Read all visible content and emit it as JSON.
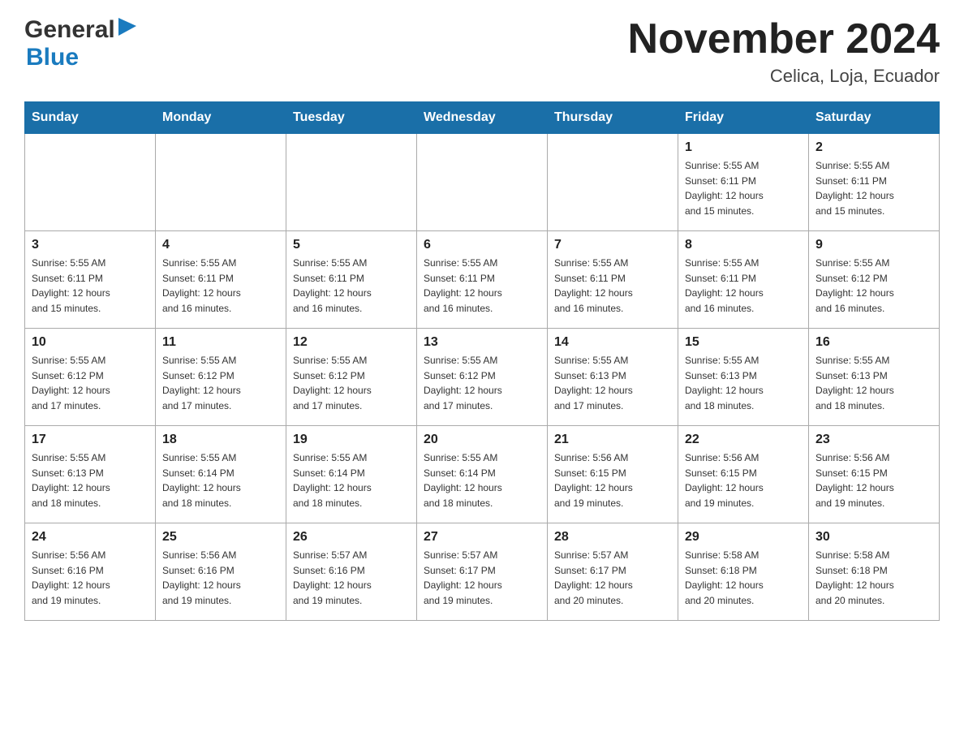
{
  "header": {
    "logo_general": "General",
    "logo_blue": "Blue",
    "month_title": "November 2024",
    "location": "Celica, Loja, Ecuador"
  },
  "days_of_week": [
    "Sunday",
    "Monday",
    "Tuesday",
    "Wednesday",
    "Thursday",
    "Friday",
    "Saturday"
  ],
  "weeks": [
    [
      {
        "day": "",
        "info": ""
      },
      {
        "day": "",
        "info": ""
      },
      {
        "day": "",
        "info": ""
      },
      {
        "day": "",
        "info": ""
      },
      {
        "day": "",
        "info": ""
      },
      {
        "day": "1",
        "info": "Sunrise: 5:55 AM\nSunset: 6:11 PM\nDaylight: 12 hours\nand 15 minutes."
      },
      {
        "day": "2",
        "info": "Sunrise: 5:55 AM\nSunset: 6:11 PM\nDaylight: 12 hours\nand 15 minutes."
      }
    ],
    [
      {
        "day": "3",
        "info": "Sunrise: 5:55 AM\nSunset: 6:11 PM\nDaylight: 12 hours\nand 15 minutes."
      },
      {
        "day": "4",
        "info": "Sunrise: 5:55 AM\nSunset: 6:11 PM\nDaylight: 12 hours\nand 16 minutes."
      },
      {
        "day": "5",
        "info": "Sunrise: 5:55 AM\nSunset: 6:11 PM\nDaylight: 12 hours\nand 16 minutes."
      },
      {
        "day": "6",
        "info": "Sunrise: 5:55 AM\nSunset: 6:11 PM\nDaylight: 12 hours\nand 16 minutes."
      },
      {
        "day": "7",
        "info": "Sunrise: 5:55 AM\nSunset: 6:11 PM\nDaylight: 12 hours\nand 16 minutes."
      },
      {
        "day": "8",
        "info": "Sunrise: 5:55 AM\nSunset: 6:11 PM\nDaylight: 12 hours\nand 16 minutes."
      },
      {
        "day": "9",
        "info": "Sunrise: 5:55 AM\nSunset: 6:12 PM\nDaylight: 12 hours\nand 16 minutes."
      }
    ],
    [
      {
        "day": "10",
        "info": "Sunrise: 5:55 AM\nSunset: 6:12 PM\nDaylight: 12 hours\nand 17 minutes."
      },
      {
        "day": "11",
        "info": "Sunrise: 5:55 AM\nSunset: 6:12 PM\nDaylight: 12 hours\nand 17 minutes."
      },
      {
        "day": "12",
        "info": "Sunrise: 5:55 AM\nSunset: 6:12 PM\nDaylight: 12 hours\nand 17 minutes."
      },
      {
        "day": "13",
        "info": "Sunrise: 5:55 AM\nSunset: 6:12 PM\nDaylight: 12 hours\nand 17 minutes."
      },
      {
        "day": "14",
        "info": "Sunrise: 5:55 AM\nSunset: 6:13 PM\nDaylight: 12 hours\nand 17 minutes."
      },
      {
        "day": "15",
        "info": "Sunrise: 5:55 AM\nSunset: 6:13 PM\nDaylight: 12 hours\nand 18 minutes."
      },
      {
        "day": "16",
        "info": "Sunrise: 5:55 AM\nSunset: 6:13 PM\nDaylight: 12 hours\nand 18 minutes."
      }
    ],
    [
      {
        "day": "17",
        "info": "Sunrise: 5:55 AM\nSunset: 6:13 PM\nDaylight: 12 hours\nand 18 minutes."
      },
      {
        "day": "18",
        "info": "Sunrise: 5:55 AM\nSunset: 6:14 PM\nDaylight: 12 hours\nand 18 minutes."
      },
      {
        "day": "19",
        "info": "Sunrise: 5:55 AM\nSunset: 6:14 PM\nDaylight: 12 hours\nand 18 minutes."
      },
      {
        "day": "20",
        "info": "Sunrise: 5:55 AM\nSunset: 6:14 PM\nDaylight: 12 hours\nand 18 minutes."
      },
      {
        "day": "21",
        "info": "Sunrise: 5:56 AM\nSunset: 6:15 PM\nDaylight: 12 hours\nand 19 minutes."
      },
      {
        "day": "22",
        "info": "Sunrise: 5:56 AM\nSunset: 6:15 PM\nDaylight: 12 hours\nand 19 minutes."
      },
      {
        "day": "23",
        "info": "Sunrise: 5:56 AM\nSunset: 6:15 PM\nDaylight: 12 hours\nand 19 minutes."
      }
    ],
    [
      {
        "day": "24",
        "info": "Sunrise: 5:56 AM\nSunset: 6:16 PM\nDaylight: 12 hours\nand 19 minutes."
      },
      {
        "day": "25",
        "info": "Sunrise: 5:56 AM\nSunset: 6:16 PM\nDaylight: 12 hours\nand 19 minutes."
      },
      {
        "day": "26",
        "info": "Sunrise: 5:57 AM\nSunset: 6:16 PM\nDaylight: 12 hours\nand 19 minutes."
      },
      {
        "day": "27",
        "info": "Sunrise: 5:57 AM\nSunset: 6:17 PM\nDaylight: 12 hours\nand 19 minutes."
      },
      {
        "day": "28",
        "info": "Sunrise: 5:57 AM\nSunset: 6:17 PM\nDaylight: 12 hours\nand 20 minutes."
      },
      {
        "day": "29",
        "info": "Sunrise: 5:58 AM\nSunset: 6:18 PM\nDaylight: 12 hours\nand 20 minutes."
      },
      {
        "day": "30",
        "info": "Sunrise: 5:58 AM\nSunset: 6:18 PM\nDaylight: 12 hours\nand 20 minutes."
      }
    ]
  ],
  "colors": {
    "header_bg": "#1a6fa8",
    "accent_blue": "#1a7bbf"
  }
}
